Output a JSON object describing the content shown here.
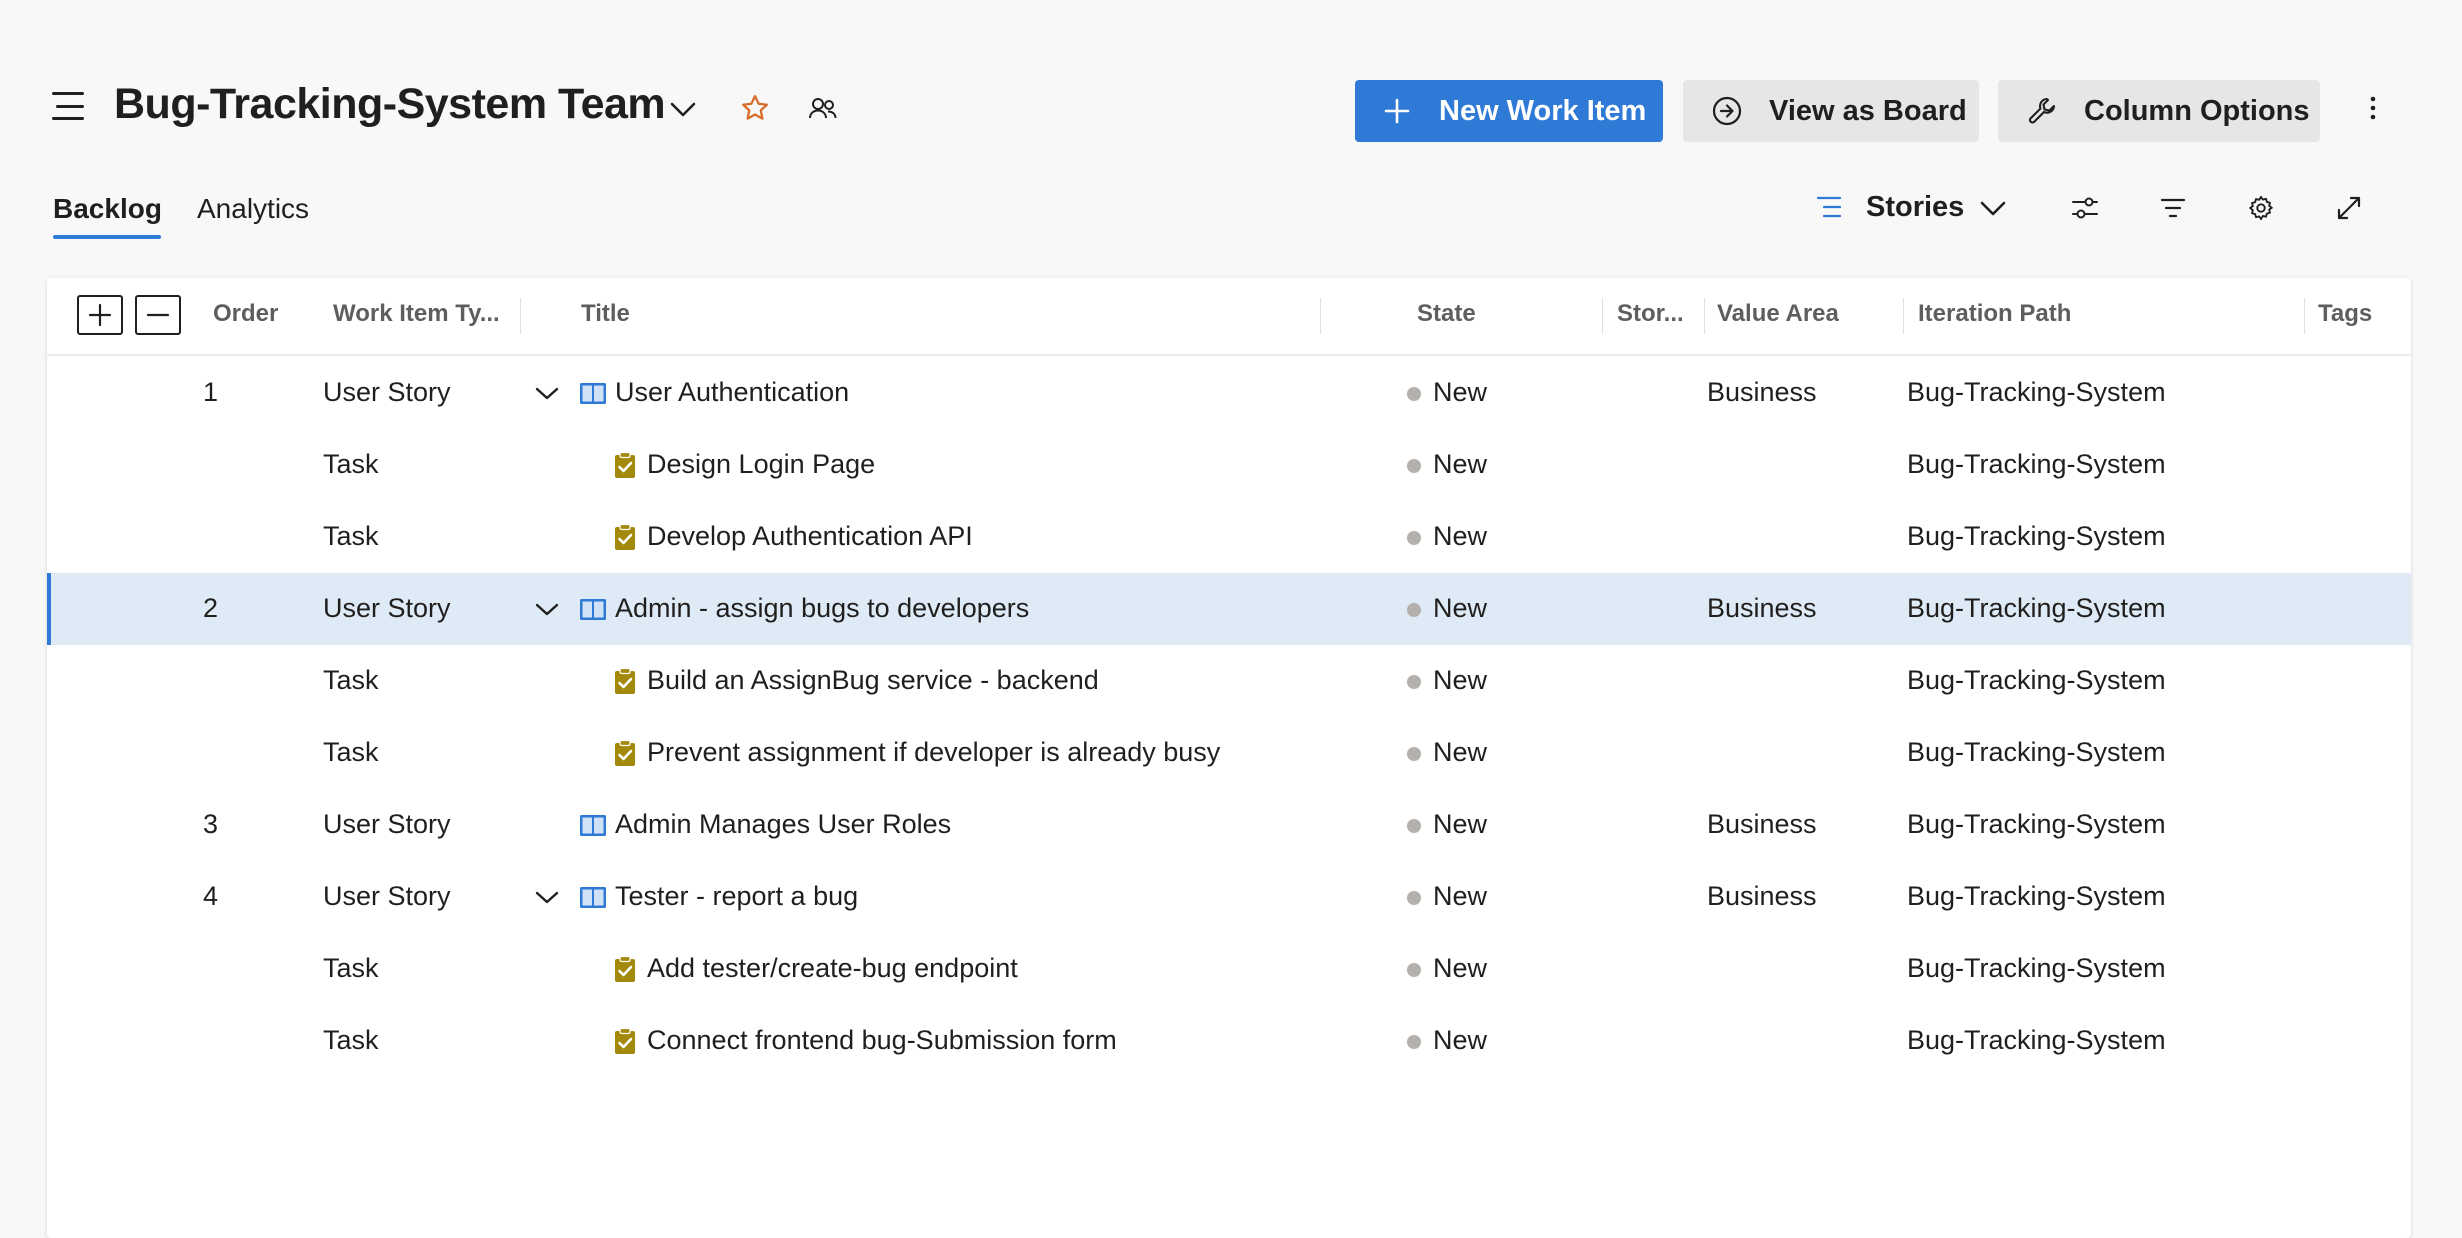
{
  "header": {
    "team_title": "Bug-Tracking-System Team",
    "new_item_label": "New Work Item",
    "view_board_label": "View as Board",
    "column_options_label": "Column Options"
  },
  "tabs": [
    {
      "label": "Backlog",
      "active": true
    },
    {
      "label": "Analytics",
      "active": false
    }
  ],
  "view": {
    "level_label": "Stories"
  },
  "columns": {
    "order": "Order",
    "type": "Work Item Ty...",
    "title": "Title",
    "state": "State",
    "story": "Stor...",
    "value_area": "Value Area",
    "iteration": "Iteration Path",
    "tags": "Tags"
  },
  "rows": [
    {
      "order": "1",
      "type": "User Story",
      "title": "User Authentication",
      "state": "New",
      "value_area": "Business",
      "iteration": "Bug-Tracking-System"
    },
    {
      "order": "",
      "type": "Task",
      "title": "Design Login Page",
      "state": "New",
      "value_area": "",
      "iteration": "Bug-Tracking-System"
    },
    {
      "order": "",
      "type": "Task",
      "title": "Develop Authentication API",
      "state": "New",
      "value_area": "",
      "iteration": "Bug-Tracking-System"
    },
    {
      "order": "2",
      "type": "User Story",
      "title": "Admin - assign bugs to developers",
      "state": "New",
      "value_area": "Business",
      "iteration": "Bug-Tracking-System"
    },
    {
      "order": "",
      "type": "Task",
      "title": "Build an AssignBug service - backend",
      "state": "New",
      "value_area": "",
      "iteration": "Bug-Tracking-System"
    },
    {
      "order": "",
      "type": "Task",
      "title": "Prevent assignment if developer is already busy",
      "state": "New",
      "value_area": "",
      "iteration": "Bug-Tracking-System"
    },
    {
      "order": "3",
      "type": "User Story",
      "title": "Admin Manages User Roles",
      "state": "New",
      "value_area": "Business",
      "iteration": "Bug-Tracking-System"
    },
    {
      "order": "4",
      "type": "User Story",
      "title": "Tester - report a bug",
      "state": "New",
      "value_area": "Business",
      "iteration": "Bug-Tracking-System"
    },
    {
      "order": "",
      "type": "Task",
      "title": "Add tester/create-bug endpoint",
      "state": "New",
      "value_area": "",
      "iteration": "Bug-Tracking-System"
    },
    {
      "order": "",
      "type": "Task",
      "title": "Connect frontend bug-Submission form",
      "state": "New",
      "value_area": "",
      "iteration": "Bug-Tracking-System"
    }
  ],
  "colors": {
    "accent": "#2f7ad6",
    "story_icon": "#2f7ad6",
    "task_icon": "#a4880a",
    "favorite_star": "#d86b2a",
    "state_new": "#b3b0ad",
    "selected_row": "#deeaf6"
  },
  "icons": {
    "menu": "hamburger-icon",
    "team_dropdown": "chevron-down-icon",
    "favorite": "star-icon",
    "members": "people-icon",
    "new_item": "plus-icon",
    "board": "arrow-circle-icon",
    "column_options": "wrench-icon",
    "more": "more-vertical-icon",
    "view_options": "sliders-icon",
    "filter": "filter-icon",
    "settings": "gear-icon",
    "fullscreen": "expand-icon",
    "expand_all": "plus-box-icon",
    "collapse_all": "minus-box-icon"
  }
}
